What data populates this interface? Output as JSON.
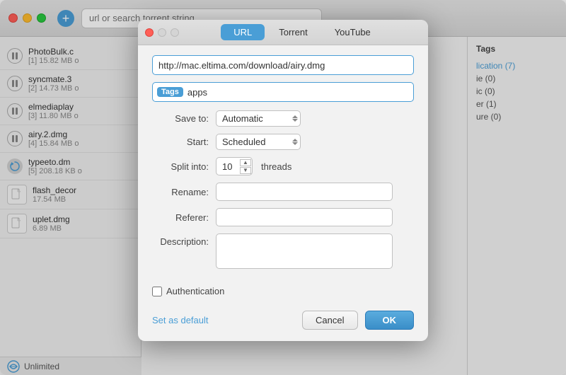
{
  "titlebar": {
    "search_placeholder": "url or search torrent string"
  },
  "tabs": {
    "url": "URL",
    "torrent": "Torrent",
    "youtube": "YouTube",
    "active": "url"
  },
  "modal": {
    "url_value": "http://mac.eltima.com/download/airy.dmg",
    "tags_label": "Tags",
    "tags_value": "apps",
    "save_to_label": "Save to:",
    "save_to_value": "Automatic",
    "start_label": "Start:",
    "start_value": "Scheduled",
    "split_into_label": "Split into:",
    "split_into_value": "10",
    "threads_label": "threads",
    "rename_label": "Rename:",
    "referer_label": "Referer:",
    "description_label": "Description:",
    "authentication_label": "Authentication",
    "set_as_default": "Set as default",
    "cancel_button": "Cancel",
    "ok_button": "OK"
  },
  "downloads": [
    {
      "name": "PhotoBulk.c",
      "meta": "[1] 15.82 MB o",
      "paused": true
    },
    {
      "name": "syncmate.3",
      "meta": "[2] 14.73 MB o",
      "paused": true
    },
    {
      "name": "elmediaplay",
      "meta": "[3] 11.80 MB o",
      "paused": true
    },
    {
      "name": "airy.2.dmg",
      "meta": "[4] 15.84 MB o",
      "paused": true
    },
    {
      "name": "typeeto.dm",
      "meta": "[5] 208.18 KB o",
      "paused": false,
      "active": true
    },
    {
      "name": "flash_decor",
      "meta": "17.54 MB",
      "paused": false
    },
    {
      "name": "uplet.dmg",
      "meta": "6.89 MB",
      "paused": false
    }
  ],
  "tags_panel": {
    "title": "Tags",
    "items": [
      {
        "label": "lication (7)",
        "active": true
      },
      {
        "label": "ie (0)",
        "active": false
      },
      {
        "label": "ic (0)",
        "active": false
      },
      {
        "label": "er (1)",
        "active": false
      },
      {
        "label": "ure (0)",
        "active": false
      }
    ]
  },
  "status_bar": {
    "label": "Unlimited"
  }
}
